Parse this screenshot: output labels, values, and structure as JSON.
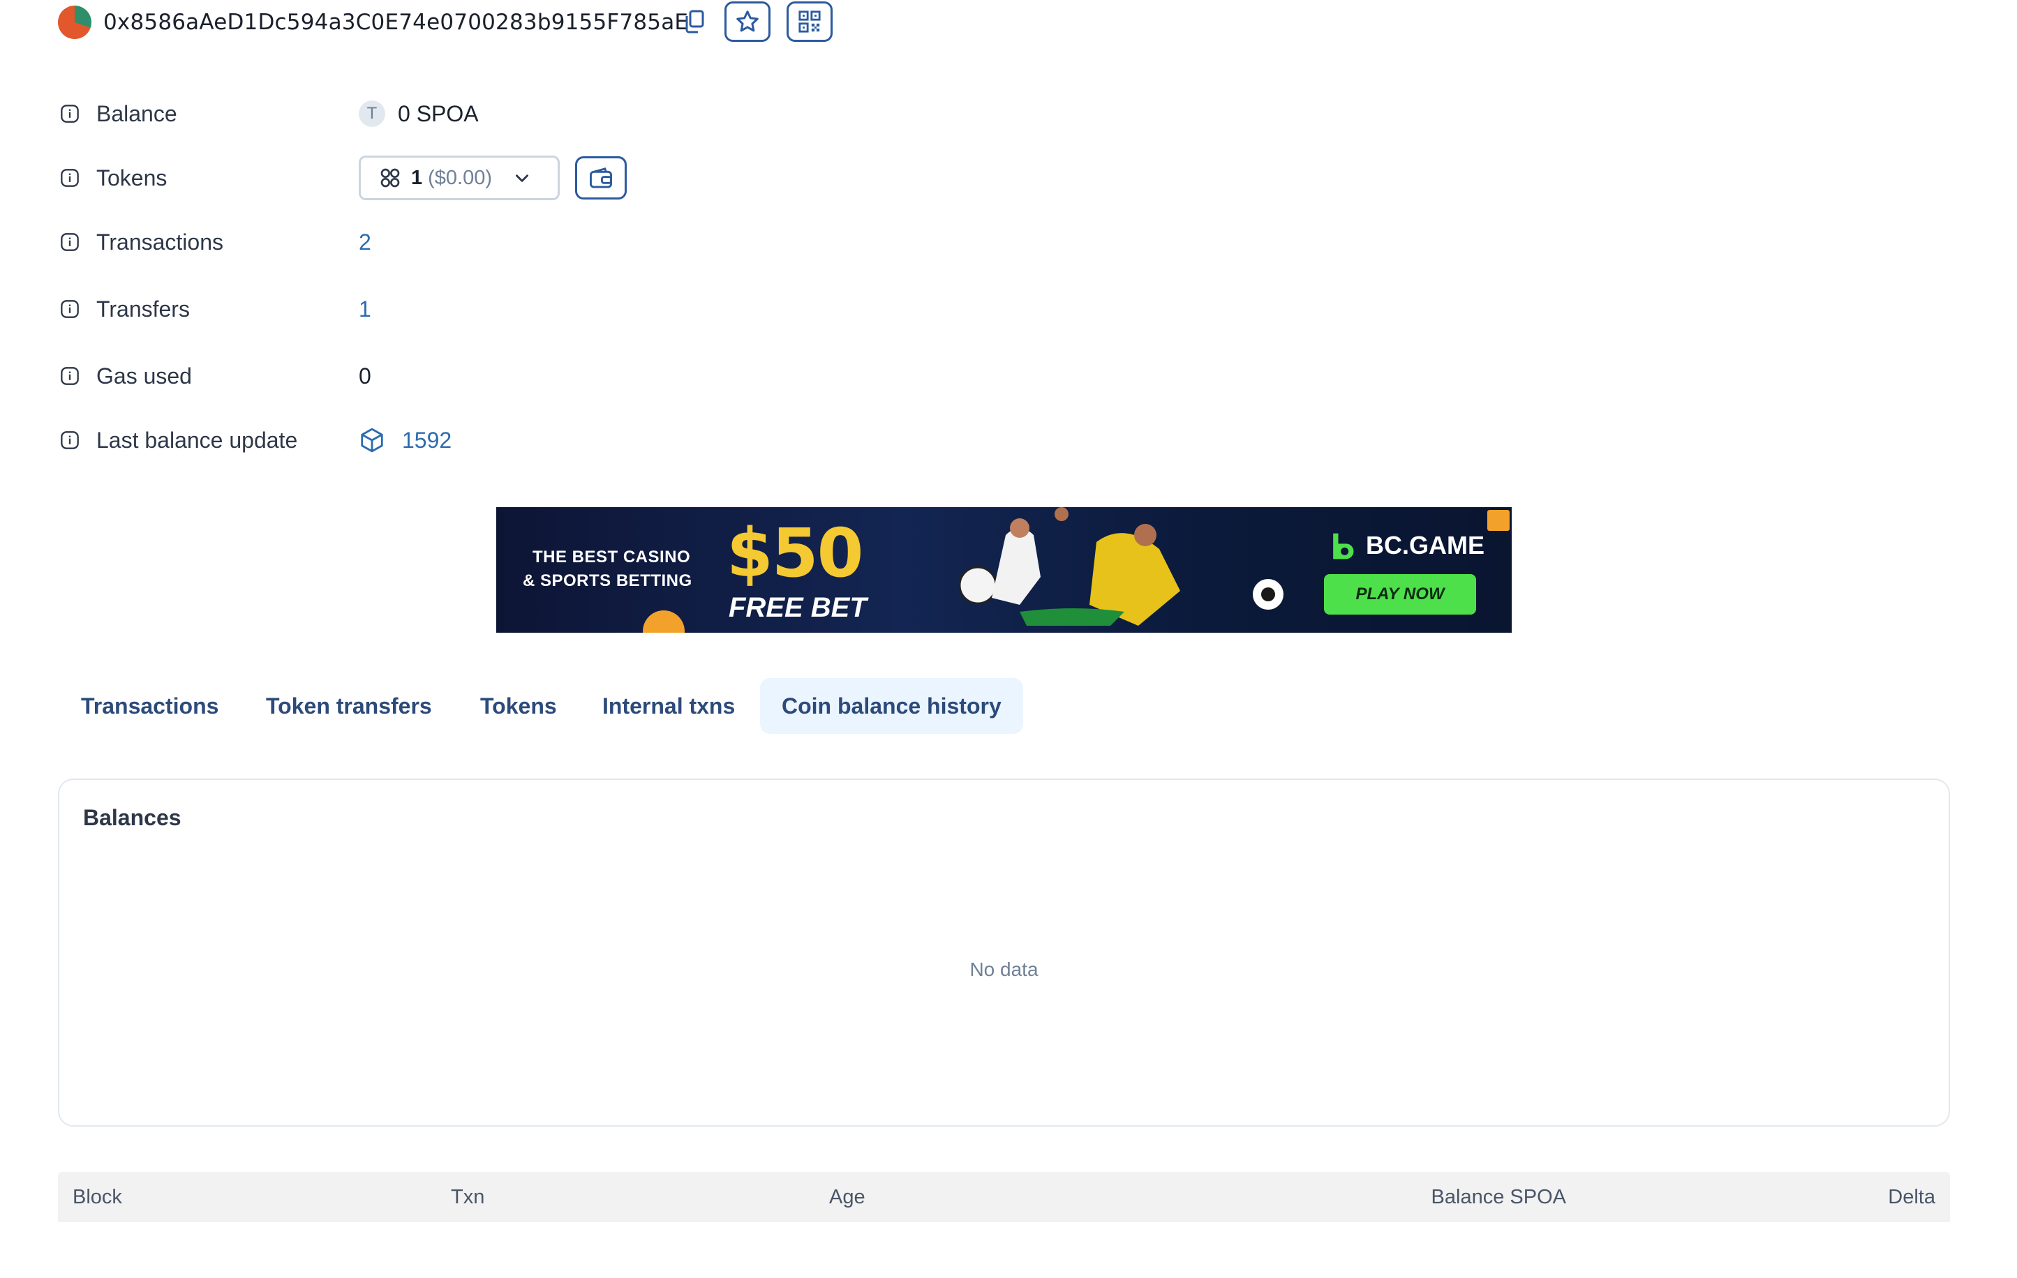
{
  "header": {
    "address": "0x8586aAeD1Dc594a3C0E74e0700283b9155F785aE"
  },
  "details": {
    "balance": {
      "label": "Balance",
      "token_letter": "T",
      "value": "0 SPOA"
    },
    "tokens": {
      "label": "Tokens",
      "count": "1",
      "usd": "($0.00)"
    },
    "transactions": {
      "label": "Transactions",
      "value": "2"
    },
    "transfers": {
      "label": "Transfers",
      "value": "1"
    },
    "gas_used": {
      "label": "Gas used",
      "value": "0"
    },
    "last_balance_update": {
      "label": "Last balance update",
      "value": "1592"
    }
  },
  "banner": {
    "line1": "THE BEST CASINO",
    "line2": "& SPORTS BETTING",
    "amount": "$50",
    "offer": "FREE BET",
    "brand": "BC.GAME",
    "cta": "PLAY NOW"
  },
  "tabs": [
    {
      "label": "Transactions"
    },
    {
      "label": "Token transfers"
    },
    {
      "label": "Tokens"
    },
    {
      "label": "Internal txns"
    },
    {
      "label": "Coin balance history",
      "active": true
    }
  ],
  "balances": {
    "title": "Balances",
    "empty": "No data"
  },
  "table": {
    "columns": [
      "Block",
      "Txn",
      "Age",
      "Balance SPOA",
      "Delta"
    ]
  },
  "colors": {
    "accent": "#2c5aa0",
    "link": "#2b6cb0",
    "tab_active_bg": "#ebf5ff",
    "cta_green": "#4ee04a"
  }
}
